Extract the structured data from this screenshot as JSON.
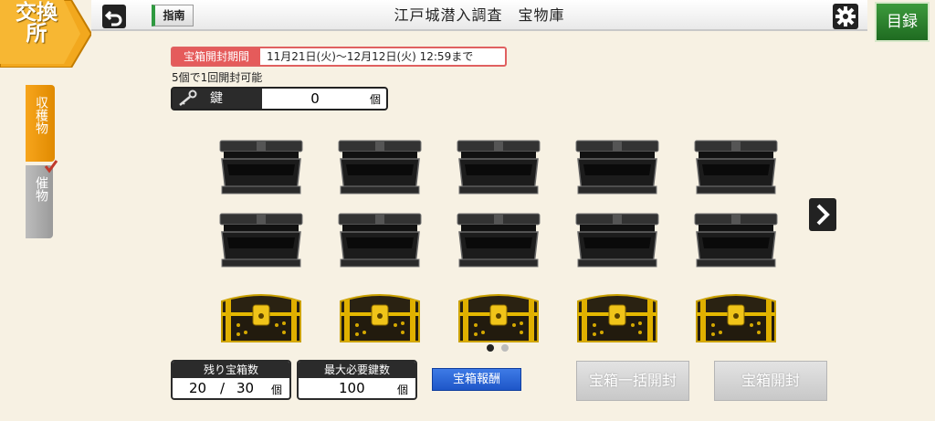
{
  "header": {
    "exchange_badge": "交換所",
    "title": "江戸城潜入調査　宝物庫",
    "guide_label": "指南",
    "catalog_label": "目録",
    "icons": {
      "back": "back-arrow-icon",
      "settings": "gear-icon"
    }
  },
  "side_tabs": [
    {
      "label": "収穫物",
      "state": "active",
      "color": "#f39c12"
    },
    {
      "label": "催物",
      "state": "inactive",
      "color": "#aaaaaa"
    }
  ],
  "period": {
    "label": "宝箱開封期間",
    "value": "11月21日(火)〜12月12日(火) 12:59まで"
  },
  "open_rule": "5個で1回開封可能",
  "key": {
    "label": "鍵",
    "count": "0",
    "unit": "個"
  },
  "chest_grid": {
    "rows": [
      [
        "opened-black",
        "opened-black",
        "opened-black",
        "opened-black",
        "opened-black"
      ],
      [
        "opened-black",
        "opened-black",
        "opened-black",
        "opened-black",
        "opened-black"
      ],
      [
        "closed-gold",
        "closed-gold",
        "closed-gold",
        "closed-gold",
        "closed-gold"
      ]
    ]
  },
  "pagination": {
    "current": 1,
    "total": 2
  },
  "stats": {
    "remaining": {
      "label": "残り宝箱数",
      "value": "20",
      "separator": "/",
      "total": "30",
      "unit": "個"
    },
    "max_keys": {
      "label": "最大必要鍵数",
      "value": "100",
      "unit": "個"
    }
  },
  "buttons": {
    "reward": "宝箱報酬",
    "bulk_open": "宝箱一括開封",
    "open": "宝箱開封"
  },
  "colors": {
    "accent_orange": "#f39c12",
    "catalog_green": "#2e8b2e",
    "reward_blue": "#2b64d8",
    "period_red": "#e55b5b"
  }
}
